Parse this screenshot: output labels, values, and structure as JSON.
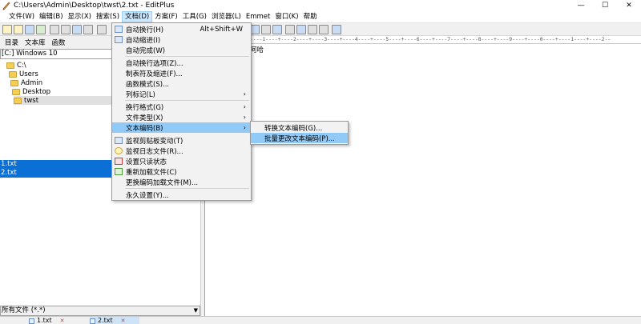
{
  "window": {
    "title": "C:\\Users\\Admin\\Desktop\\twst\\2.txt - EditPlus",
    "minimize": "—",
    "maximize": "☐",
    "close": "✕"
  },
  "menubar": [
    {
      "label": "文件(W)"
    },
    {
      "label": "编辑(B)"
    },
    {
      "label": "显示(X)"
    },
    {
      "label": "搜索(S)"
    },
    {
      "label": "文档(D)",
      "active": true
    },
    {
      "label": "方案(F)"
    },
    {
      "label": "工具(G)"
    },
    {
      "label": "浏览器(L)"
    },
    {
      "label": "Emmet"
    },
    {
      "label": "窗口(K)"
    },
    {
      "label": "帮助"
    }
  ],
  "panel": {
    "tabs": [
      "目录",
      "文本库",
      "函数"
    ],
    "drive": "[C:] Windows 10",
    "tree": [
      "C:\\",
      "Users",
      "Admin",
      "Desktop",
      "twst"
    ],
    "files": [
      "1.txt",
      "2.txt"
    ],
    "filter": "所有文件 (*.*)",
    "filter_arrow": "▼"
  },
  "editor": {
    "ruler": "----1----+----2----+----3----+----4----+----5----+----6----+----7----+----8----+----9----+----0----+----1----+----2--",
    "content": "阿哈"
  },
  "doctabs": [
    {
      "label": "1.txt"
    },
    {
      "label": "2.txt",
      "active": true
    }
  ],
  "doc_menu": {
    "items": [
      {
        "label": "自动换行(H)",
        "shortcut": "Alt+Shift+W",
        "icon": "wrap-icon"
      },
      {
        "label": "自动缩进(I)",
        "icon": "indent-icon"
      },
      {
        "label": "自动完成(W)"
      },
      {
        "sep": true
      },
      {
        "label": "自动换行选项(Z)..."
      },
      {
        "label": "制表符及缩进(F)..."
      },
      {
        "label": "函数模式(S)..."
      },
      {
        "label": "列标记(L)",
        "submenu": true
      },
      {
        "sep": true
      },
      {
        "label": "换行格式(G)",
        "submenu": true
      },
      {
        "label": "文件类型(X)",
        "submenu": true
      },
      {
        "label": "文本编码(B)",
        "submenu": true,
        "highlight": true
      },
      {
        "label": "监视剪贴板变动(T)",
        "icon": "clipboard-icon"
      },
      {
        "label": "监视日志文件(R)...",
        "icon": "lightbulb-icon"
      },
      {
        "label": "设置只读状态",
        "icon": "readonly-icon"
      },
      {
        "label": "重新加载文件(C)",
        "icon": "reload-icon"
      },
      {
        "label": "更换编码加载文件(M)..."
      },
      {
        "sep": true
      },
      {
        "label": "永久设置(Y)..."
      }
    ],
    "submenu_arrow": "›"
  },
  "encoding_submenu": {
    "items": [
      {
        "label": "转换文本编码(G)..."
      },
      {
        "label": "批量更改文本编码(P)...",
        "highlight": true
      }
    ]
  }
}
